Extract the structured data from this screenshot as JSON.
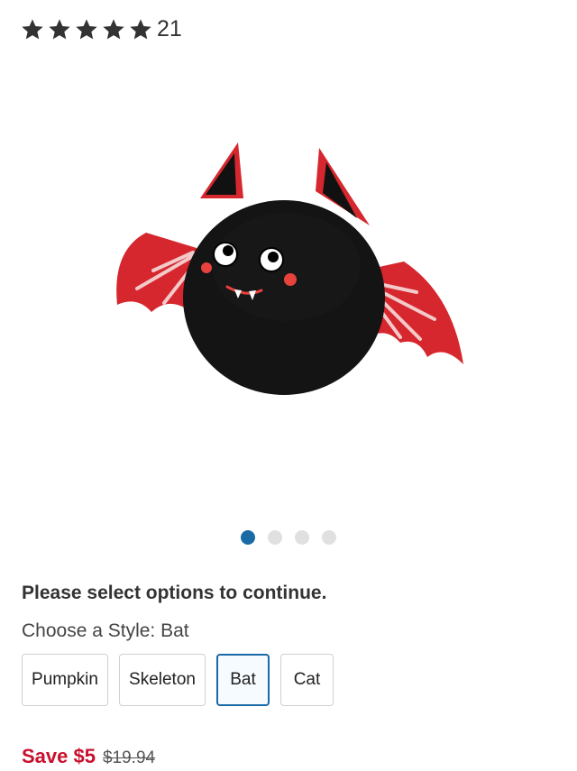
{
  "rating": {
    "stars": 5,
    "count": "21"
  },
  "image": {
    "alt": "Bat plush"
  },
  "carousel": {
    "total": 4,
    "active": 0
  },
  "notice": "Please select options to continue.",
  "style": {
    "label": "Choose a Style: Bat",
    "options": [
      "Pumpkin",
      "Skeleton",
      "Bat",
      "Cat"
    ],
    "selected": "Bat"
  },
  "price": {
    "save": "Save $5",
    "original": "$19.94"
  },
  "colors": {
    "accent": "#1a6aa6",
    "sale": "#c8102e",
    "bat_red": "#d6262e"
  }
}
